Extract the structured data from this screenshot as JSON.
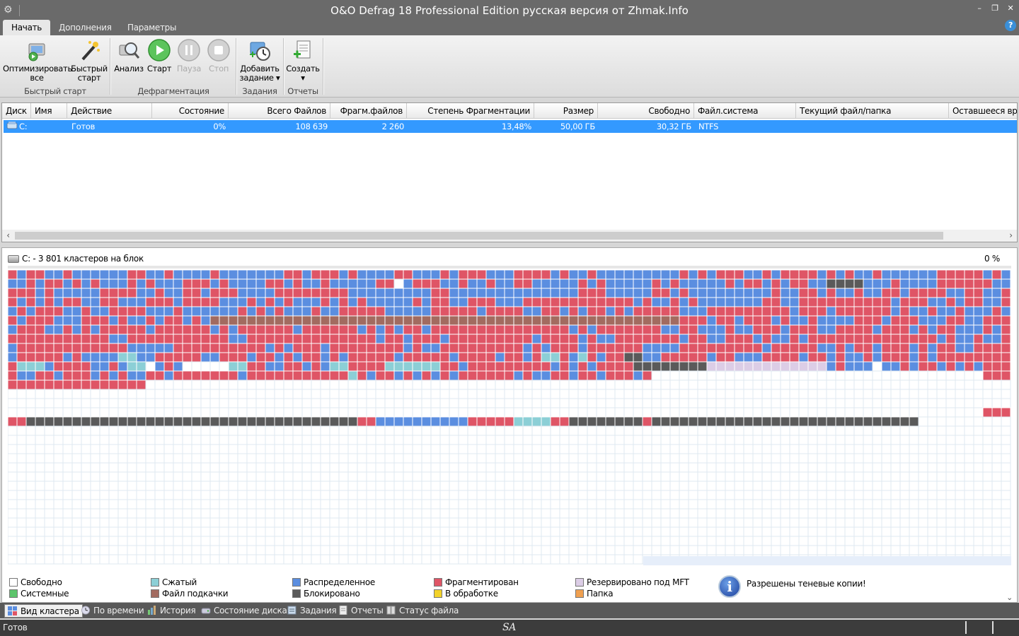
{
  "window": {
    "title": "O&O Defrag 18 Professional Edition русская версия от Zhmak.Info",
    "minimize": "–",
    "restore": "❐",
    "close": "✕"
  },
  "ribbon_tabs": [
    "Начать",
    "Дополнения",
    "Параметры"
  ],
  "help": "?",
  "ribbon": {
    "buttons": {
      "optimize_all": [
        "Оптимизировать",
        "все"
      ],
      "quick_start": [
        "Быстрый",
        "старт"
      ],
      "analysis": "Анализ",
      "start": "Старт",
      "pause": "Пауза",
      "stop": "Стоп",
      "add_task": [
        "Добавить",
        "задание ▾"
      ],
      "create": [
        "Создать",
        "▾"
      ]
    },
    "groups": {
      "quick_start": "Быстрый старт",
      "defrag": "Дефрагментация",
      "tasks": "Задания",
      "reports": "Отчеты"
    }
  },
  "disk_table": {
    "columns": [
      "Диск",
      "Имя",
      "Действие",
      "Состояние",
      "Всего Файлов",
      "Фрагм.файлов",
      "Степень Фрагментации",
      "Размер",
      "Свободно",
      "Файл.система",
      "Текущий файл/папка",
      "Оставшееся время"
    ],
    "rows": [
      {
        "disk": "C:",
        "name": "",
        "action": "Готов",
        "state": "0%",
        "total_files": "108 639",
        "frag_files": "2 260",
        "frag_degree": "13,48%",
        "size": "50,00 ГБ",
        "free": "30,32 ГБ",
        "fs": "NTFS",
        "current": "",
        "remaining": ""
      }
    ],
    "scroll_left": "‹",
    "scroll_right": "›"
  },
  "cluster_view": {
    "header": "C: - 3 801 кластеров на блок",
    "percent": "0 %",
    "legend": [
      {
        "label": "Свободно",
        "color": "#ffffff"
      },
      {
        "label": "Системные",
        "color": "#5cc46b"
      },
      {
        "label": "Сжатый",
        "color": "#8ccfd6"
      },
      {
        "label": "Файл подкачки",
        "color": "#a26b60"
      },
      {
        "label": "Распределенное",
        "color": "#5b8ee0"
      },
      {
        "label": "Блокировано",
        "color": "#5a5a5a"
      },
      {
        "label": "Фрагментирован",
        "color": "#df5566"
      },
      {
        "label": "В обработке",
        "color": "#f2d22a"
      },
      {
        "label": "Резервировано под MFT",
        "color": "#dccde6"
      },
      {
        "label": "Папка",
        "color": "#f0a050"
      }
    ],
    "info_icon": "i",
    "info": "Разрешены теневые копии!",
    "scroll_down": "⌄"
  },
  "bottom_tabs": [
    "Вид кластера",
    "По времени",
    "История",
    "Состояние диска",
    "Задания",
    "Отчеты",
    "Статус файла"
  ],
  "status": {
    "text": "Готов",
    "mark": "SA"
  },
  "colors": {
    "fragmented": "#df5566",
    "allocated": "#5b8ee0",
    "locked": "#5a5a5a",
    "compressed": "#8ccfd6",
    "pagefile": "#a26b60",
    "mft_reserved": "#dccde6",
    "free": "#ffffff",
    "selection": "#3399ff"
  }
}
